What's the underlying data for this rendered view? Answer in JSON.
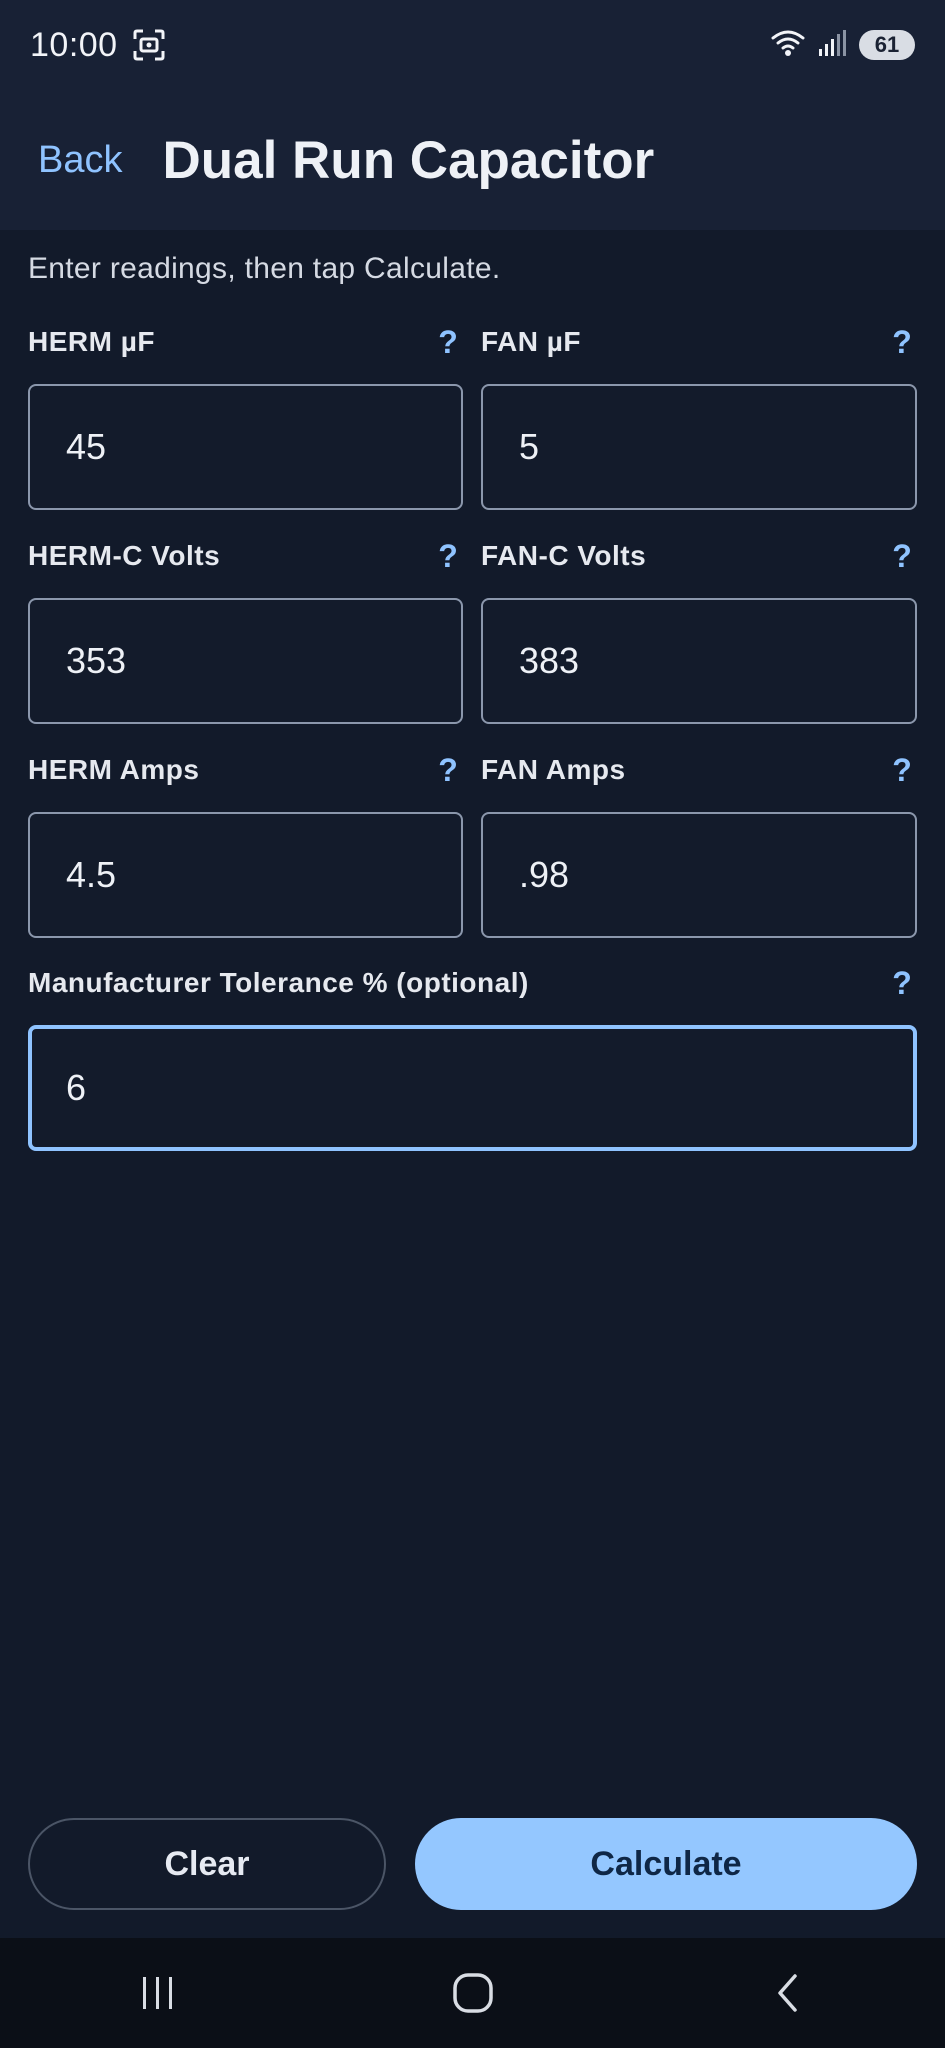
{
  "status_bar": {
    "time": "10:00",
    "battery": "61",
    "icons": [
      "screenshot-icon",
      "wifi-icon",
      "signal-icon",
      "battery-icon"
    ]
  },
  "header": {
    "back_label": "Back",
    "title": "Dual Run Capacitor"
  },
  "instructions": "Enter readings, then tap Calculate.",
  "fields": {
    "herm_uf": {
      "label": "HERM µF",
      "value": "45"
    },
    "fan_uf": {
      "label": "FAN µF",
      "value": "5"
    },
    "herm_c_volts": {
      "label": "HERM-C Volts",
      "value": "353"
    },
    "fan_c_volts": {
      "label": "FAN-C Volts",
      "value": "383"
    },
    "herm_amps": {
      "label": "HERM Amps",
      "value": "4.5"
    },
    "fan_amps": {
      "label": "FAN Amps",
      "value": ".98"
    },
    "tolerance": {
      "label": "Manufacturer Tolerance % (optional)",
      "value": "6"
    }
  },
  "help_glyph": "?",
  "actions": {
    "clear_label": "Clear",
    "calculate_label": "Calculate"
  },
  "colors": {
    "background": "#121a2a",
    "header": "#182135",
    "accent": "#8fc3ff",
    "primary_button": "#94c7ff",
    "nav_bar": "#0b0f17"
  }
}
